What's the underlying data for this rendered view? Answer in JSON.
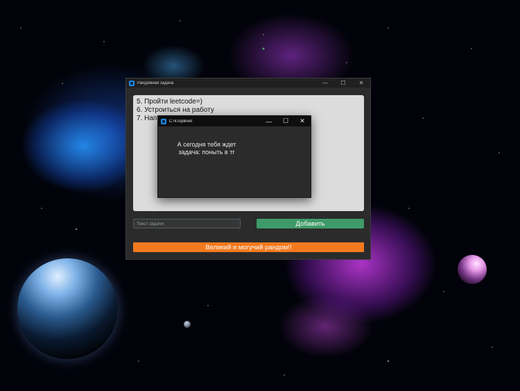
{
  "main_window": {
    "title": "Рандомная задача",
    "controls": {
      "minimize": "—",
      "maximize": "☐",
      "close": "✕"
    },
    "task_lines": [
      "5. Пройти leetcode=)",
      "6. Устроиться на работу",
      "7. Напи"
    ],
    "task_input": {
      "placeholder": "Текст задачи",
      "value": ""
    },
    "add_button": "Добавить",
    "random_button": "Великий и могучий рандом!!"
  },
  "popup_window": {
    "title": "CTkToplevel",
    "controls": {
      "minimize": "—",
      "maximize": "☐",
      "close": "✕"
    },
    "message_line1": "А сегодня тебя ждет",
    "message_line2": "задача: поныть в тг"
  },
  "colors": {
    "add_button": "#3e9a68",
    "random_button": "#f47a1f",
    "textbox_bg": "#dcdcdc",
    "window_bg": "#2b2b2b"
  }
}
